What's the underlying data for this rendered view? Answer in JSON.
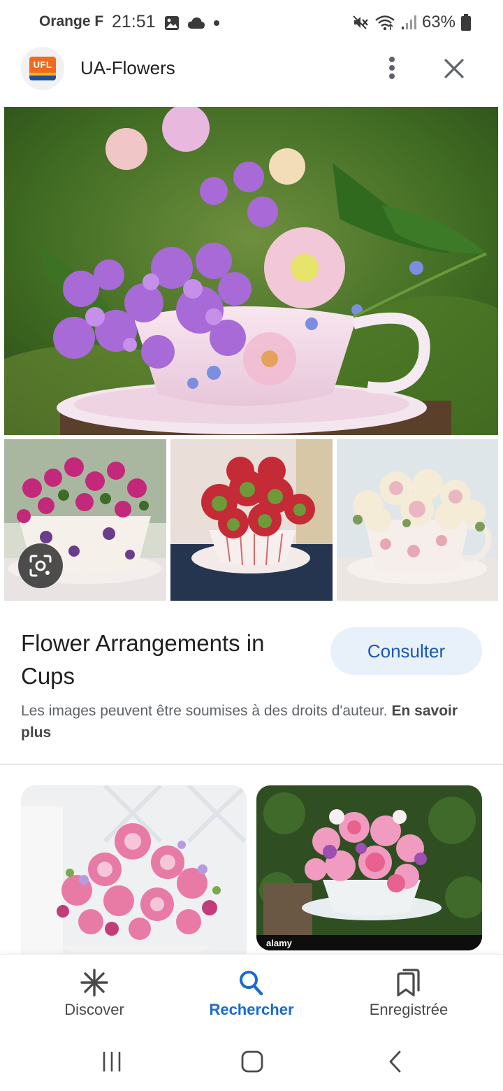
{
  "status_bar": {
    "carrier": "Orange F",
    "time": "21:51",
    "battery": "63%",
    "icons_left": [
      "gallery-icon",
      "cloud-icon",
      "dot-icon"
    ],
    "icons_right": [
      "mute-icon",
      "wifi-icon",
      "signal-icon",
      "battery-icon"
    ]
  },
  "header": {
    "logo_text": "UFL",
    "title": "UA-Flowers",
    "more_icon": "more-vert-icon",
    "close_icon": "close-icon"
  },
  "gallery": {
    "main_image": "flowers in pink teacup with purple phlox",
    "thumbnails": [
      "pansies in teacup",
      "red ranunculus in striped cup",
      "cream roses in floral teacup"
    ],
    "lens_icon": "lens-search-icon"
  },
  "result": {
    "title": "Flower Arrangements in Cups",
    "consult_label": "Consulter",
    "copyright_text": "Les images peuvent être soumises à des droits d'auteur.",
    "learn_more": "En savoir plus"
  },
  "related": {
    "items": [
      "pink roses bouquet",
      "pink roses in teacup"
    ],
    "watermark": "alamy"
  },
  "bottom_nav": {
    "items": [
      {
        "label": "Discover",
        "icon": "asterisk-icon",
        "active": false
      },
      {
        "label": "Rechercher",
        "icon": "search-icon",
        "active": true
      },
      {
        "label": "Enregistrée",
        "icon": "bookmarks-icon",
        "active": false
      }
    ]
  },
  "system_nav": {
    "items": [
      "recent-apps-icon",
      "home-icon",
      "back-icon"
    ]
  },
  "colors": {
    "accent": "#1a6ad1",
    "consult_bg": "#e8f0fa",
    "consult_text": "#1a57b5"
  }
}
